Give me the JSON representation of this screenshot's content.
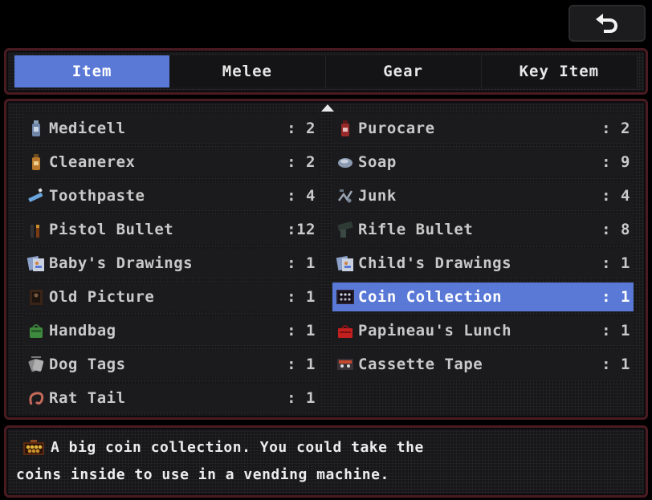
{
  "back_button": {
    "icon": "back-arrow-icon"
  },
  "tabs": [
    {
      "label": "Item",
      "active": true
    },
    {
      "label": "Melee",
      "active": false
    },
    {
      "label": "Gear",
      "active": false
    },
    {
      "label": "Key Item",
      "active": false
    }
  ],
  "items_left": [
    {
      "name": "Medicell",
      "count": ": 2",
      "icon": "medicell-bottle-icon"
    },
    {
      "name": "Cleanerex",
      "count": ": 2",
      "icon": "cleanerex-bottle-icon"
    },
    {
      "name": "Toothpaste",
      "count": ": 4",
      "icon": "toothpaste-icon"
    },
    {
      "name": "Pistol Bullet",
      "count": ":12",
      "icon": "pistol-bullet-icon"
    },
    {
      "name": "Baby's Drawings",
      "count": ": 1",
      "icon": "drawings-icon"
    },
    {
      "name": "Old Picture",
      "count": ": 1",
      "icon": "old-picture-icon"
    },
    {
      "name": "Handbag",
      "count": ": 1",
      "icon": "handbag-icon"
    },
    {
      "name": "Dog Tags",
      "count": ": 1",
      "icon": "dog-tags-icon"
    },
    {
      "name": "Rat Tail",
      "count": ": 1",
      "icon": "rat-tail-icon"
    }
  ],
  "items_right": [
    {
      "name": "Purocare",
      "count": ": 2",
      "icon": "purocare-bottle-icon"
    },
    {
      "name": "Soap",
      "count": ": 9",
      "icon": "soap-icon"
    },
    {
      "name": "Junk",
      "count": ": 4",
      "icon": "junk-icon"
    },
    {
      "name": "Rifle Bullet",
      "count": ": 8",
      "icon": "rifle-bullet-icon"
    },
    {
      "name": "Child's Drawings",
      "count": ": 1",
      "icon": "drawings-icon"
    },
    {
      "name": "Coin Collection",
      "count": ": 1",
      "icon": "coin-collection-icon",
      "selected": true
    },
    {
      "name": "Papineau's Lunch",
      "count": ": 1",
      "icon": "lunchbox-icon"
    },
    {
      "name": "Cassette Tape",
      "count": ": 1",
      "icon": "cassette-tape-icon"
    }
  ],
  "description": {
    "icon": "coin-collection-icon",
    "line1": "A big coin collection. You could take the",
    "line2": "coins inside to use in a vending machine."
  },
  "colors": {
    "selection": "#5a79d6",
    "panel_border": "#4b1b22",
    "panel_bg": "#17171a"
  }
}
